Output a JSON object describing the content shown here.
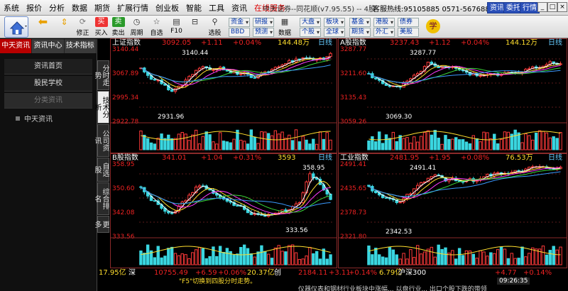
{
  "menu": {
    "items": [
      "系统",
      "报价",
      "分析",
      "数据",
      "期货",
      "扩展行情",
      "创业板",
      "智能",
      "工具",
      "资讯",
      "在线服务"
    ],
    "window_title": "中天证券--同花顺(v7.95.55) -- 4股",
    "hotline": "客服热线:95105885  0571-56768888",
    "tabs": [
      "资讯",
      "委托",
      "行情"
    ],
    "window_controls": [
      "_",
      "□",
      "×"
    ]
  },
  "toolbar": {
    "buttons": [
      "修正",
      "买入",
      "卖出",
      "周期",
      "自选股",
      "F10",
      "选股"
    ],
    "group1": [
      "资金",
      "研报",
      "BBD",
      "预测"
    ],
    "group1_label": "数据",
    "group2": [
      "大盘",
      "板块",
      "个股",
      "全球"
    ],
    "group3": [
      "基金",
      "港股",
      "期货",
      "外汇",
      "债券",
      "美股"
    ]
  },
  "sidebar": {
    "tabs": [
      "中天资讯",
      "资讯中心",
      "技术指标"
    ],
    "items": [
      "资讯首页",
      "股民学校",
      "分类资讯"
    ],
    "tree_item": "中天资讯"
  },
  "vtabs": [
    "分时走势",
    "技术分析",
    "公司资讯",
    "自选股",
    "综合排名",
    "更多"
  ],
  "panels": [
    {
      "name": "上证指数",
      "price": "3092.05",
      "change": "+1.11",
      "pct": "+0.04%",
      "vol": "144.48万",
      "period": "日线",
      "y_labels": [
        "3140.44",
        "3067.89",
        "2995.34",
        "2922.78"
      ],
      "high_label": "3140.44",
      "low_label": "2931.96"
    },
    {
      "name": "A股指数",
      "price": "3237.43",
      "change": "+1.12",
      "pct": "+0.04%",
      "vol": "144.12万",
      "period": "日线",
      "y_labels": [
        "3287.77",
        "3211.60",
        "3135.43",
        "3059.26"
      ],
      "high_label": "3287.77",
      "low_label": "3069.30"
    },
    {
      "name": "B股指数",
      "price": "341.01",
      "change": "+1.04",
      "pct": "+0.31%",
      "vol": "3593",
      "period": "日线",
      "y_labels": [
        "358.95",
        "350.60",
        "342.08",
        "333.56"
      ],
      "high_label": "358.95",
      "low_label": "333.56"
    },
    {
      "name": "工业指数",
      "price": "2481.95",
      "change": "+1.95",
      "pct": "+0.08%",
      "vol": "76.53万",
      "period": "日线",
      "y_labels": [
        "2491.41",
        "2435.65",
        "2378.73",
        "2321.80"
      ],
      "high_label": "2491.41",
      "low_label": "2342.53"
    }
  ],
  "status": {
    "sh_amount": "17.95亿",
    "sz_name": "深",
    "sz_price": "10755.49",
    "sz_change": "+6.59",
    "sz_pct": "+0.06%",
    "cy_amount": "20.37亿",
    "cy_name": "创",
    "cy_price": "2184.11",
    "cy_change": "+3.11",
    "cy_pct": "+0.14%",
    "hs_amount": "6.79亿",
    "hs_name": "沪深300",
    "hs_change": "+4.77",
    "hs_pct": "+0.14%"
  },
  "tip": "\"F5\"切换到四股分时走势。",
  "clock": "09:26:35",
  "news": "仪器仪表和钢材行业板块中涨幅...   以盘行业...   出口个股下跌的带领"
}
